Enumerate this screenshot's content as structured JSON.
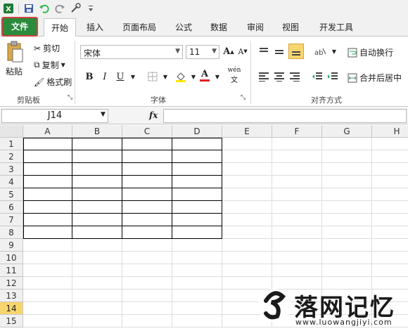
{
  "qat": {
    "icons": [
      "excel-logo-icon",
      "save-icon",
      "undo-icon",
      "redo-icon",
      "tools-icon",
      "customize-icon"
    ]
  },
  "tabs": [
    {
      "label": "文件"
    },
    {
      "label": "开始"
    },
    {
      "label": "插入"
    },
    {
      "label": "页面布局"
    },
    {
      "label": "公式"
    },
    {
      "label": "数据"
    },
    {
      "label": "审阅"
    },
    {
      "label": "视图"
    },
    {
      "label": "开发工具"
    }
  ],
  "ribbon": {
    "clipboard": {
      "paste": "粘贴",
      "cut": "剪切",
      "copy": "复制",
      "format_painter": "格式刷",
      "group": "剪贴板"
    },
    "font": {
      "name": "宋体",
      "size": "11",
      "bold": "B",
      "italic": "I",
      "underline": "U",
      "grow": "A",
      "shrink": "A",
      "color": "A",
      "phonetic": "wén",
      "group": "字体"
    },
    "alignment": {
      "wrap": "自动换行",
      "merge": "合并后居中",
      "group": "对齐方式"
    }
  },
  "formula_bar": {
    "name_box": "J14",
    "fx": "fx",
    "formula": ""
  },
  "grid": {
    "columns": [
      "A",
      "B",
      "C",
      "D",
      "E",
      "F",
      "G",
      "H"
    ],
    "rows": [
      "1",
      "2",
      "3",
      "4",
      "5",
      "6",
      "7",
      "8",
      "9",
      "10",
      "11",
      "12",
      "13",
      "14",
      "15"
    ],
    "selected_row": "14"
  },
  "watermark": {
    "text": "落网记忆",
    "url": "www.luowangjiyi.com"
  },
  "colors": {
    "file_tab": "#2a8b3c",
    "file_tab_outline": "#d24040",
    "selected_row_header": "#f8d66e"
  }
}
